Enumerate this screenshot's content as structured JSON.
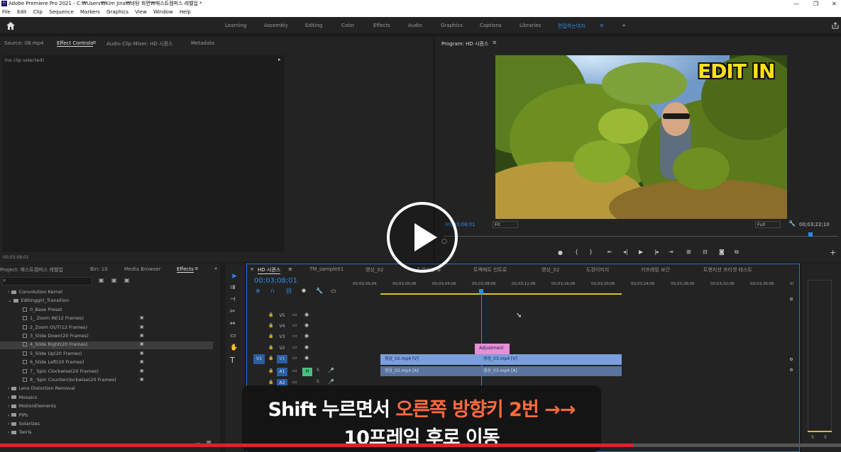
{
  "window": {
    "title": "Adobe Premiere Pro 2021 - C:₩Users₩Kim Jina₩바탕 화면₩패스트캠퍼스 레벨업 *",
    "app_icon": "Pr"
  },
  "menu": [
    "File",
    "Edit",
    "Clip",
    "Sequence",
    "Markers",
    "Graphics",
    "View",
    "Window",
    "Help"
  ],
  "workspaces": [
    "Learning",
    "Assembly",
    "Editing",
    "Color",
    "Effects",
    "Audio",
    "Graphics",
    "Captions",
    "Libraries",
    "편집하는여자"
  ],
  "source_panel": {
    "tabs": [
      "Source: 08.mp4",
      "Effect Controls",
      "Audio Clip Mixer: HD 시퀀스",
      "Metadata"
    ],
    "active_tab": "Effect Controls",
    "no_clip": "(no clip selected)",
    "timecode": "00;03;08;01"
  },
  "program_panel": {
    "title": "Program: HD 시퀀스",
    "overlay_text": "EDIT IN",
    "current_time": "00;03;08;01",
    "fit": "Fit",
    "quality": "Full",
    "duration": "00;03;22;10"
  },
  "project_panel": {
    "tabs": [
      "Project: 패스트캠퍼스 레벨업",
      "Bin: 10",
      "Media Browser",
      "Effects"
    ],
    "active_tab": "Effects",
    "items": [
      {
        "label": "Convolution Kernel",
        "type": "folder",
        "indent": 1
      },
      {
        "label": "Editinggirl_Transition",
        "type": "folder",
        "indent": 1,
        "open": true
      },
      {
        "label": "0_Base Preset",
        "type": "fx",
        "indent": 2
      },
      {
        "label": "1_ Zoom IN(12 Frames)",
        "type": "fx",
        "indent": 2
      },
      {
        "label": "2_Zoom OUT(12 Frames)",
        "type": "fx",
        "indent": 2
      },
      {
        "label": "3_Slide Down(20 Frames)",
        "type": "fx",
        "indent": 2
      },
      {
        "label": "4_Slide Right(20 Frames)",
        "type": "fx",
        "indent": 2,
        "selected": true
      },
      {
        "label": "5_Slide Up(20 Frames)",
        "type": "fx",
        "indent": 2
      },
      {
        "label": "6_Slide Left(20 Frames)",
        "type": "fx",
        "indent": 2
      },
      {
        "label": "7_ Spin Clockwise(20 Frames)",
        "type": "fx",
        "indent": 2
      },
      {
        "label": "8_ Spin Counterclockwise(20 Frames)",
        "type": "fx",
        "indent": 2
      },
      {
        "label": "Lens Distortion Removal",
        "type": "folder",
        "indent": 1
      },
      {
        "label": "Mosaics",
        "type": "folder",
        "indent": 1
      },
      {
        "label": "MotionElements",
        "type": "folder",
        "indent": 1
      },
      {
        "label": "PiPs",
        "type": "folder",
        "indent": 1
      },
      {
        "label": "Solarizes",
        "type": "folder",
        "indent": 1
      },
      {
        "label": "Twirls",
        "type": "folder",
        "indent": 1
      }
    ]
  },
  "timeline": {
    "tabs": [
      "HD 시퀀스",
      "TM_sample01",
      "영상_02",
      "트랜지션 뷰",
      "트랙매트 인트로",
      "영상_02",
      "도장이미지",
      "키프레임 보간",
      "트랜지션 프리셋 테스트"
    ],
    "timecode": "00;03;08;01",
    "ruler": [
      "00;02;56;04",
      "00;03;00;06",
      "00;03;04;06",
      "00;03;08;06",
      "00;03;12;06",
      "00;03;16;06",
      "00;03;20;06",
      "00;03;24;06",
      "00;03;28;06",
      "00;03;32;06",
      "00;03;36;06",
      "0("
    ],
    "video_tracks": [
      "V5",
      "V4",
      "V3",
      "V2",
      "V1"
    ],
    "audio_tracks": [
      "A1",
      "A2"
    ],
    "source_patch_v": "V1",
    "clips": {
      "adjustment": "Adjustment",
      "v1_a": "영상_02.mp4 [V]",
      "v1_b": "영상_03.mp4 [V]",
      "a1_a": "영상_02.mp4 [A]",
      "a1_b": "영상_03.mp4 [A]"
    }
  },
  "subtitle": {
    "line1_a": "Shift 누르면서 ",
    "line1_b": "오른쪽 방향키 2번 →→",
    "line2": "10프레임 후로 이동"
  },
  "video_progress": 0.753,
  "colors": {
    "accent": "#2d8ceb",
    "clip_video": "#7b9fdc",
    "clip_adjust": "#e68ed6",
    "highlight": "#ff6a3d",
    "progress": "#e0202b"
  }
}
